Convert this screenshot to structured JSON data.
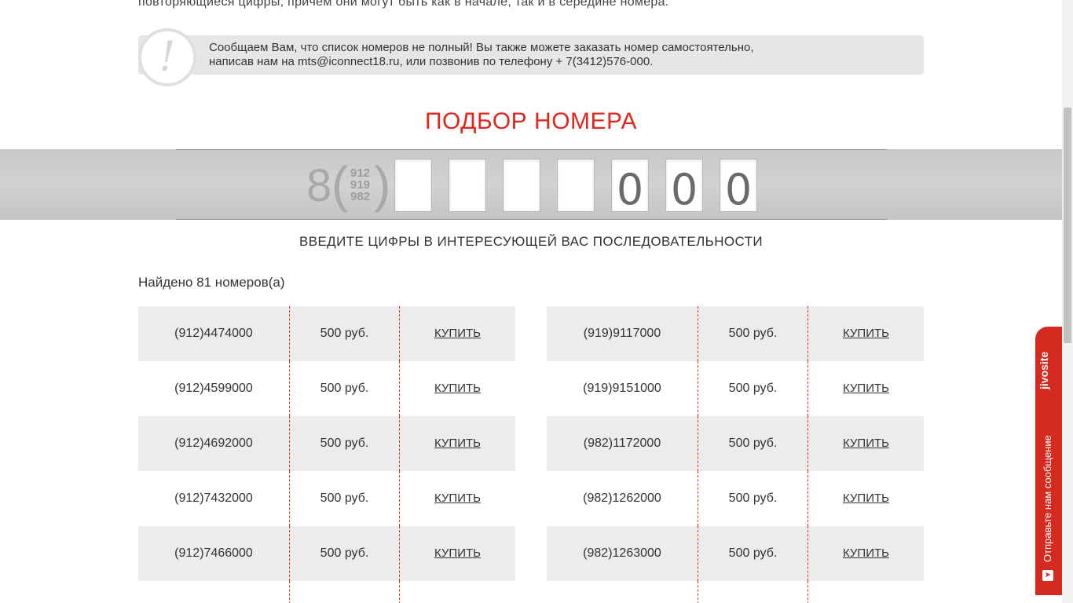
{
  "intro": {
    "tail_text": "повторяющиеся цифры, причем они могут быть как в начале, так и в середине номера."
  },
  "notice": {
    "icon": "!",
    "line1": "Сообщаем Вам, что список номеров не полный! Вы также можете заказать номер самостоятельно,",
    "line2": "написав нам на mts@iconnect18.ru, или позвонив по телефону + 7(3412)576-000."
  },
  "picker": {
    "title": "ПОДБОР НОМЕРА",
    "prefix": "8",
    "open_paren": "(",
    "close_paren": ")",
    "codes": [
      "912",
      "919",
      "982"
    ],
    "digits": [
      "",
      "",
      "",
      "",
      "0",
      "0",
      "0"
    ],
    "hint": "ВВЕДИТЕ ЦИФРЫ В ИНТЕРЕСУЮЩЕЙ ВАС ПОСЛЕДОВАТЕЛЬНОСТИ"
  },
  "results": {
    "found_text": "Найдено 81 номеров(а)",
    "buy_label": "КУПИТЬ",
    "left": [
      {
        "number": "(912)4474000",
        "price": "500 руб."
      },
      {
        "number": "(912)4599000",
        "price": "500 руб."
      },
      {
        "number": "(912)4692000",
        "price": "500 руб."
      },
      {
        "number": "(912)7432000",
        "price": "500 руб."
      },
      {
        "number": "(912)7466000",
        "price": "500 руб."
      }
    ],
    "right": [
      {
        "number": "(919)9117000",
        "price": "500 руб."
      },
      {
        "number": "(919)9151000",
        "price": "500 руб."
      },
      {
        "number": "(982)1172000",
        "price": "500 руб."
      },
      {
        "number": "(982)1262000",
        "price": "500 руб."
      },
      {
        "number": "(982)1263000",
        "price": "500 руб."
      }
    ]
  },
  "jivo": {
    "brand": "jivosite",
    "message": "Отправьте нам сообщение",
    "icon": "send-icon"
  },
  "colors": {
    "accent": "#e1261c",
    "jivo": "#d42a1f",
    "row_shade": "#ececec"
  }
}
